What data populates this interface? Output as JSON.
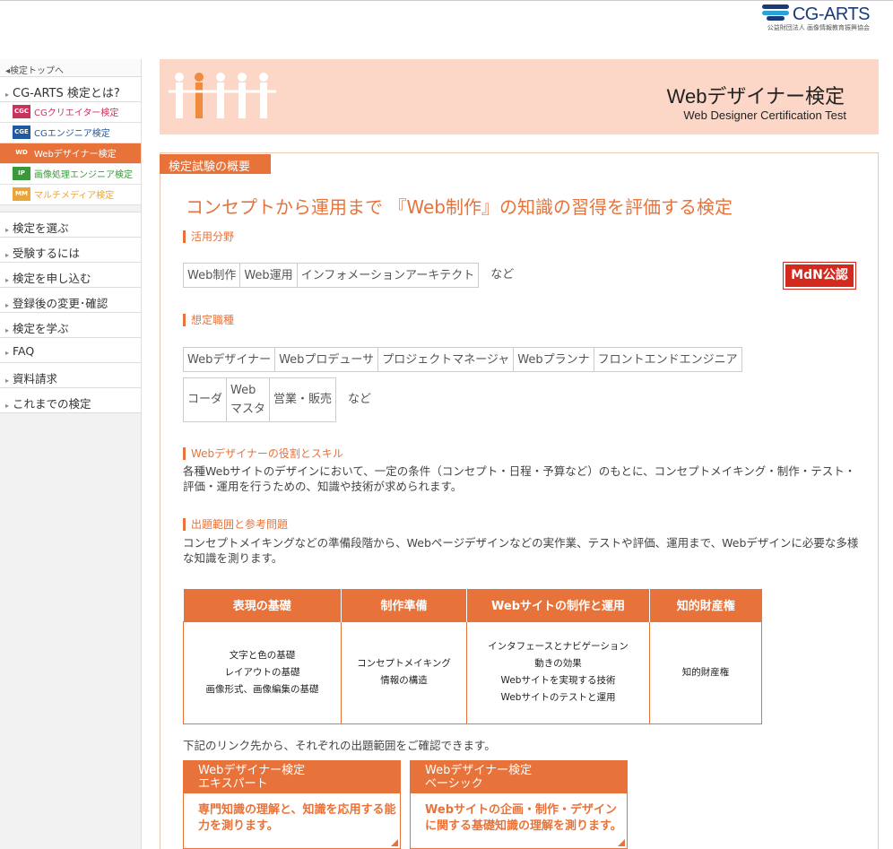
{
  "header": {
    "logo_name": "CG-ARTS",
    "logo_sub": "公益財団法人 画像情報教育振興協会"
  },
  "sidebar": {
    "top_link": "検定トップへ",
    "cgarts": "CG-ARTS 検定とは?",
    "subs": [
      {
        "icon": "CGC",
        "label": "CGクリエイター検定",
        "color": "#c8345c",
        "textcolor": "#c8345c"
      },
      {
        "icon": "CGE",
        "label": "CGエンジニア検定",
        "color": "#1d5aa3",
        "textcolor": "#1d5aa3"
      },
      {
        "icon": "WD",
        "label": "Webデザイナー検定",
        "color": "#e8733a",
        "textcolor": "#ffffff"
      },
      {
        "icon": "IP",
        "label": "画像処理エンジニア検定",
        "color": "#3a9a3a",
        "textcolor": "#3a9a3a"
      },
      {
        "icon": "MM",
        "label": "マルチメディア検定",
        "color": "#e8a53a",
        "textcolor": "#e8a53a"
      }
    ],
    "items": [
      "検定を選ぶ",
      "受験するには",
      "検定を申し込む",
      "登録後の変更･確認",
      "検定を学ぶ",
      "FAQ",
      "資料請求",
      "これまでの検定"
    ]
  },
  "banner": {
    "title": "Webデザイナー検定",
    "subtitle": "Web Designer Certification Test"
  },
  "section": {
    "tab": "検定試験の概要",
    "headline": "コンセプトから運用まで 『Web制作』の知識の習得を評価する検定",
    "field_head": "活用分野",
    "fields": [
      "Web制作",
      "Web運用",
      "インフォメーションアーキテクト"
    ],
    "nado": "など",
    "badge": "MdN公認",
    "job_head": "想定職種",
    "jobs_row1": [
      "Webデザイナー",
      "Webプロデューサ",
      "プロジェクトマネージャ",
      "Webプランナ",
      "フロントエンドエンジニア"
    ],
    "jobs_row2": [
      "コーダ",
      "Web\nマスタ",
      "営業・販売"
    ],
    "role_head": "Webデザイナーの役割とスキル",
    "role_text": "各種Webサイトのデザインにおいて、一定の条件（コンセプト・日程・予算など）のもとに、コンセプトメイキング・制作・テスト・評価・運用を行うための、知識や技術が求められます。",
    "scope_head": "出題範囲と参考問題",
    "scope_text": "コンセプトメイキングなどの準備段階から、Webページデザインなどの実作業、テストや評価、運用まで、Webデザインに必要な多様な知識を測ります。",
    "table": {
      "headers": [
        "表現の基礎",
        "制作準備",
        "Webサイトの制作と運用",
        "知的財産権"
      ],
      "cells": [
        [
          "文字と色の基礎",
          "レイアウトの基礎",
          "画像形式、画像編集の基礎"
        ],
        [
          "コンセプトメイキング",
          "情報の構造"
        ],
        [
          "インタフェースとナビゲーション",
          "動きの効果",
          "Webサイトを実現する技術",
          "Webサイトのテストと運用"
        ],
        [
          "知的財産権"
        ]
      ]
    },
    "link_intro": "下記のリンク先から、それぞれの出題範囲をご確認できます。",
    "links": [
      {
        "head1": "Webデザイナー検定",
        "head2": "エキスパート",
        "body": "専門知識の理解と、知識を応用する能力を測ります。"
      },
      {
        "head1": "Webデザイナー検定",
        "head2": "ベーシック",
        "body": "Webサイトの企画・制作・デザインに関する基礎知識の理解を測ります。"
      }
    ]
  }
}
